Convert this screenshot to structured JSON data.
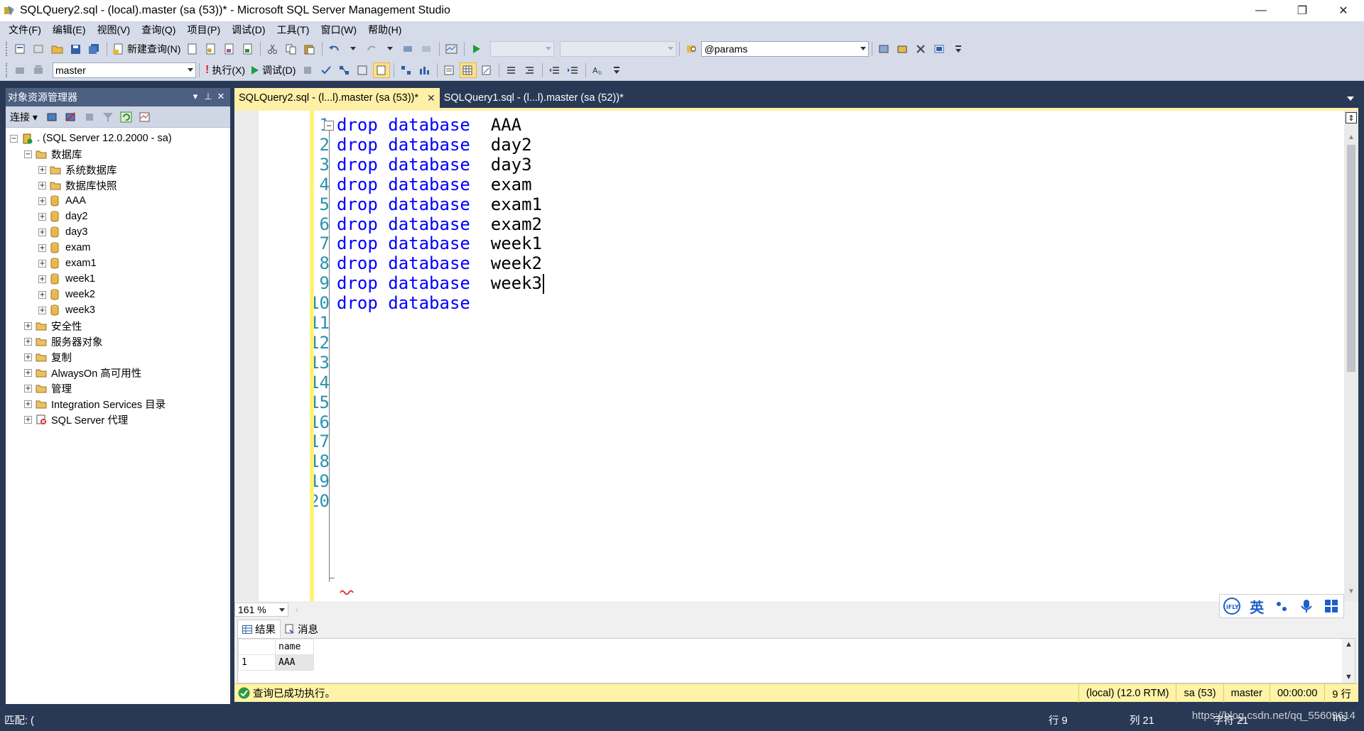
{
  "window": {
    "title": "SQLQuery2.sql - (local).master (sa (53))* - Microsoft SQL Server Management Studio",
    "minimize": "—",
    "restore": "❐",
    "close": "✕"
  },
  "menu": [
    "文件(F)",
    "编辑(E)",
    "视图(V)",
    "查询(Q)",
    "项目(P)",
    "调试(D)",
    "工具(T)",
    "窗口(W)",
    "帮助(H)"
  ],
  "toolbar1": {
    "new_query": "新建查询(N)",
    "params_value": "@params"
  },
  "toolbar2": {
    "database": "master",
    "execute": "执行(X)",
    "debug": "调试(D)"
  },
  "object_explorer": {
    "title": "对象资源管理器",
    "connect": "连接",
    "pin": "▾ ⊥ ✕",
    "server": ". (SQL Server 12.0.2000 - sa)",
    "databases_folder": "数据库",
    "db_children": [
      "系统数据库",
      "数据库快照",
      "AAA",
      "day2",
      "day3",
      "exam",
      "exam1",
      "week1",
      "week2",
      "week3"
    ],
    "folders": [
      "安全性",
      "服务器对象",
      "复制",
      "AlwaysOn 高可用性",
      "管理",
      "Integration Services 目录"
    ],
    "agent": "SQL Server 代理"
  },
  "tabs": [
    {
      "label": "SQLQuery2.sql - (l...l).master (sa (53))*",
      "active": true
    },
    {
      "label": "SQLQuery1.sql - (l...l).master (sa (52))*",
      "active": false
    }
  ],
  "editor": {
    "keywords": "drop database",
    "lines": [
      {
        "num": "1",
        "name": "AAA"
      },
      {
        "num": "2",
        "name": "day2"
      },
      {
        "num": "3",
        "name": "day3"
      },
      {
        "num": "4",
        "name": "exam"
      },
      {
        "num": "5",
        "name": "exam1"
      },
      {
        "num": "6",
        "name": "exam2"
      },
      {
        "num": "7",
        "name": "week1"
      },
      {
        "num": "8",
        "name": "week2"
      },
      {
        "num": "9",
        "name": "week3"
      },
      {
        "num": "10",
        "name": ""
      }
    ],
    "empty_line_numbers": [
      "11",
      "12",
      "13",
      "14",
      "15",
      "16",
      "17",
      "18",
      "19",
      "20"
    ],
    "zoom": "161 %"
  },
  "results": {
    "tab_results": "结果",
    "tab_messages": "消息",
    "column": "name",
    "row_num": "1",
    "row_value": "AAA"
  },
  "query_status": {
    "message": "查询已成功执行。",
    "server": "(local) (12.0 RTM)",
    "user": "sa (53)",
    "database": "master",
    "time": "00:00:00",
    "rows": "9 行"
  },
  "statusbar": {
    "left": "匹配: (",
    "row": "行 9",
    "col": "列 21",
    "char": "字符 21",
    "ins": "Ins"
  },
  "ime": {
    "lang": "英"
  },
  "watermark": "https://blog.csdn.net/qq_55609614",
  "colors": {
    "chrome_bg": "#293955",
    "toolbar_bg": "#d6dbe9",
    "active_tab": "#fff0a8",
    "keyword": "#0000ff",
    "line_number": "#2b91af"
  }
}
